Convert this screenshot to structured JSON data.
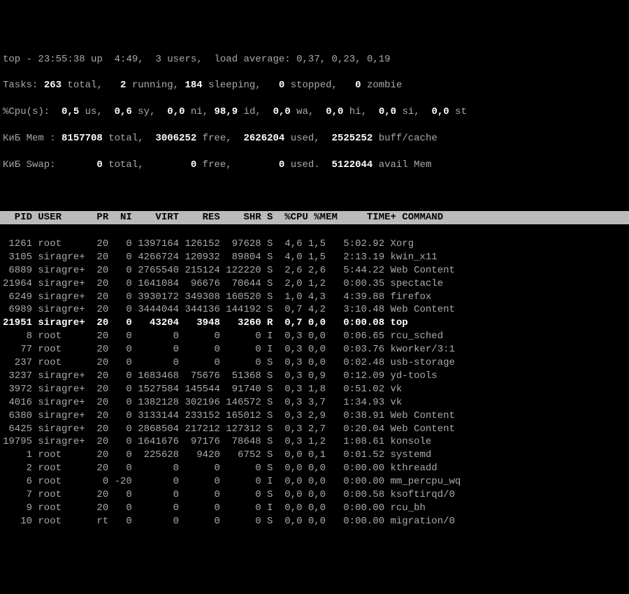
{
  "summary": {
    "line1_prefix": "top - ",
    "time": "23:55:38",
    "uptime": " up  4:49,  ",
    "users": "3",
    "users_suffix": " users,  load average: ",
    "load1": "0,37",
    "load_sep1": ", ",
    "load2": "0,23",
    "load_sep2": ", ",
    "load3": "0,19",
    "line2_prefix": "Tasks: ",
    "total": "263",
    "total_suffix": " total,   ",
    "running": "2",
    "running_suffix": " running, ",
    "sleeping": "184",
    "sleeping_suffix": " sleeping,   ",
    "stopped": "0",
    "stopped_suffix": " stopped,   ",
    "zombie": "0",
    "zombie_suffix": " zombie",
    "line3_prefix": "%Cpu(s):  ",
    "cpu_us": "0,5",
    "cpu_us_suffix": " us,  ",
    "cpu_sy": "0,6",
    "cpu_sy_suffix": " sy,  ",
    "cpu_ni": "0,0",
    "cpu_ni_suffix": " ni, ",
    "cpu_id": "98,9",
    "cpu_id_suffix": " id,  ",
    "cpu_wa": "0,0",
    "cpu_wa_suffix": " wa,  ",
    "cpu_hi": "0,0",
    "cpu_hi_suffix": " hi,  ",
    "cpu_si": "0,0",
    "cpu_si_suffix": " si,  ",
    "cpu_st": "0,0",
    "cpu_st_suffix": " st",
    "line4_prefix": "КиБ Mem : ",
    "mem_total": "8157708",
    "mem_total_suffix": " total,  ",
    "mem_free": "3006252",
    "mem_free_suffix": " free,  ",
    "mem_used": "2626204",
    "mem_used_suffix": " used,  ",
    "mem_buff": "2525252",
    "mem_buff_suffix": " buff/cache",
    "line5_prefix": "КиБ Swap:       ",
    "swap_total": "0",
    "swap_total_suffix": " total,        ",
    "swap_free": "0",
    "swap_free_suffix": " free,        ",
    "swap_used": "0",
    "swap_used_suffix": " used.  ",
    "swap_avail": "5122044",
    "swap_avail_suffix": " avail Mem "
  },
  "columns": "  PID USER      PR  NI    VIRT    RES    SHR S  %CPU %MEM     TIME+ COMMAND                   ",
  "processes": [
    {
      "pid": " 1261",
      "user": "root    ",
      "pr": "20",
      "ni": "  0",
      "virt": "1397164",
      "res": "126152",
      "shr": " 97628",
      "s": "S",
      "cpu": " 4,6",
      "mem": "1,5",
      "time": "  5:02.92",
      "cmd": "Xorg",
      "running": false
    },
    {
      "pid": " 3105",
      "user": "siragre+",
      "pr": "20",
      "ni": "  0",
      "virt": "4266724",
      "res": "120932",
      "shr": " 89804",
      "s": "S",
      "cpu": " 4,0",
      "mem": "1,5",
      "time": "  2:13.19",
      "cmd": "kwin_x11",
      "running": false
    },
    {
      "pid": " 6889",
      "user": "siragre+",
      "pr": "20",
      "ni": "  0",
      "virt": "2765540",
      "res": "215124",
      "shr": "122220",
      "s": "S",
      "cpu": " 2,6",
      "mem": "2,6",
      "time": "  5:44.22",
      "cmd": "Web Content",
      "running": false
    },
    {
      "pid": "21964",
      "user": "siragre+",
      "pr": "20",
      "ni": "  0",
      "virt": "1641084",
      "res": " 96676",
      "shr": " 70644",
      "s": "S",
      "cpu": " 2,0",
      "mem": "1,2",
      "time": "  0:00.35",
      "cmd": "spectacle",
      "running": false
    },
    {
      "pid": " 6249",
      "user": "siragre+",
      "pr": "20",
      "ni": "  0",
      "virt": "3930172",
      "res": "349308",
      "shr": "160520",
      "s": "S",
      "cpu": " 1,0",
      "mem": "4,3",
      "time": "  4:39.88",
      "cmd": "firefox",
      "running": false
    },
    {
      "pid": " 6989",
      "user": "siragre+",
      "pr": "20",
      "ni": "  0",
      "virt": "3444044",
      "res": "344136",
      "shr": "144192",
      "s": "S",
      "cpu": " 0,7",
      "mem": "4,2",
      "time": "  3:10.48",
      "cmd": "Web Content",
      "running": false
    },
    {
      "pid": "21951",
      "user": "siragre+",
      "pr": "20",
      "ni": "  0",
      "virt": "  43204",
      "res": "  3948",
      "shr": "  3260",
      "s": "R",
      "cpu": " 0,7",
      "mem": "0,0",
      "time": "  0:00.08",
      "cmd": "top",
      "running": true
    },
    {
      "pid": "    8",
      "user": "root    ",
      "pr": "20",
      "ni": "  0",
      "virt": "      0",
      "res": "     0",
      "shr": "     0",
      "s": "I",
      "cpu": " 0,3",
      "mem": "0,0",
      "time": "  0:06.65",
      "cmd": "rcu_sched",
      "running": false
    },
    {
      "pid": "   77",
      "user": "root    ",
      "pr": "20",
      "ni": "  0",
      "virt": "      0",
      "res": "     0",
      "shr": "     0",
      "s": "I",
      "cpu": " 0,3",
      "mem": "0,0",
      "time": "  0:03.76",
      "cmd": "kworker/3:1",
      "running": false
    },
    {
      "pid": "  237",
      "user": "root    ",
      "pr": "20",
      "ni": "  0",
      "virt": "      0",
      "res": "     0",
      "shr": "     0",
      "s": "S",
      "cpu": " 0,3",
      "mem": "0,0",
      "time": "  0:02.48",
      "cmd": "usb-storage",
      "running": false
    },
    {
      "pid": " 3237",
      "user": "siragre+",
      "pr": "20",
      "ni": "  0",
      "virt": "1683468",
      "res": " 75676",
      "shr": " 51368",
      "s": "S",
      "cpu": " 0,3",
      "mem": "0,9",
      "time": "  0:12.09",
      "cmd": "yd-tools",
      "running": false
    },
    {
      "pid": " 3972",
      "user": "siragre+",
      "pr": "20",
      "ni": "  0",
      "virt": "1527584",
      "res": "145544",
      "shr": " 91740",
      "s": "S",
      "cpu": " 0,3",
      "mem": "1,8",
      "time": "  0:51.02",
      "cmd": "vk",
      "running": false
    },
    {
      "pid": " 4016",
      "user": "siragre+",
      "pr": "20",
      "ni": "  0",
      "virt": "1382128",
      "res": "302196",
      "shr": "146572",
      "s": "S",
      "cpu": " 0,3",
      "mem": "3,7",
      "time": "  1:34.93",
      "cmd": "vk",
      "running": false
    },
    {
      "pid": " 6380",
      "user": "siragre+",
      "pr": "20",
      "ni": "  0",
      "virt": "3133144",
      "res": "233152",
      "shr": "165012",
      "s": "S",
      "cpu": " 0,3",
      "mem": "2,9",
      "time": "  0:38.91",
      "cmd": "Web Content",
      "running": false
    },
    {
      "pid": " 6425",
      "user": "siragre+",
      "pr": "20",
      "ni": "  0",
      "virt": "2868504",
      "res": "217212",
      "shr": "127312",
      "s": "S",
      "cpu": " 0,3",
      "mem": "2,7",
      "time": "  0:20.04",
      "cmd": "Web Content",
      "running": false
    },
    {
      "pid": "19795",
      "user": "siragre+",
      "pr": "20",
      "ni": "  0",
      "virt": "1641676",
      "res": " 97176",
      "shr": " 78648",
      "s": "S",
      "cpu": " 0,3",
      "mem": "1,2",
      "time": "  1:08.61",
      "cmd": "konsole",
      "running": false
    },
    {
      "pid": "    1",
      "user": "root    ",
      "pr": "20",
      "ni": "  0",
      "virt": " 225628",
      "res": "  9420",
      "shr": "  6752",
      "s": "S",
      "cpu": " 0,0",
      "mem": "0,1",
      "time": "  0:01.52",
      "cmd": "systemd",
      "running": false
    },
    {
      "pid": "    2",
      "user": "root    ",
      "pr": "20",
      "ni": "  0",
      "virt": "      0",
      "res": "     0",
      "shr": "     0",
      "s": "S",
      "cpu": " 0,0",
      "mem": "0,0",
      "time": "  0:00.00",
      "cmd": "kthreadd",
      "running": false
    },
    {
      "pid": "    6",
      "user": "root    ",
      "pr": " 0",
      "ni": "-20",
      "virt": "      0",
      "res": "     0",
      "shr": "     0",
      "s": "I",
      "cpu": " 0,0",
      "mem": "0,0",
      "time": "  0:00.00",
      "cmd": "mm_percpu_wq",
      "running": false
    },
    {
      "pid": "    7",
      "user": "root    ",
      "pr": "20",
      "ni": "  0",
      "virt": "      0",
      "res": "     0",
      "shr": "     0",
      "s": "S",
      "cpu": " 0,0",
      "mem": "0,0",
      "time": "  0:00.58",
      "cmd": "ksoftirqd/0",
      "running": false
    },
    {
      "pid": "    9",
      "user": "root    ",
      "pr": "20",
      "ni": "  0",
      "virt": "      0",
      "res": "     0",
      "shr": "     0",
      "s": "I",
      "cpu": " 0,0",
      "mem": "0,0",
      "time": "  0:00.00",
      "cmd": "rcu_bh",
      "running": false
    },
    {
      "pid": "   10",
      "user": "root    ",
      "pr": "rt",
      "ni": "  0",
      "virt": "      0",
      "res": "     0",
      "shr": "     0",
      "s": "S",
      "cpu": " 0,0",
      "mem": "0,0",
      "time": "  0:00.00",
      "cmd": "migration/0",
      "running": false
    }
  ]
}
